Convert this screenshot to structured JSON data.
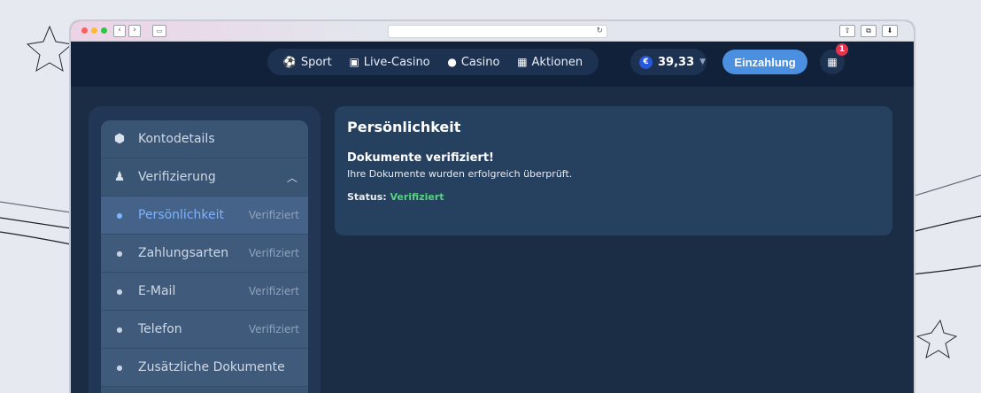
{
  "nav": {
    "items": [
      {
        "label": "Sport",
        "icon": "soccer-ball-icon"
      },
      {
        "label": "Live-Casino",
        "icon": "live-tv-icon"
      },
      {
        "label": "Casino",
        "icon": "casino-chip-icon"
      },
      {
        "label": "Aktionen",
        "icon": "gift-icon"
      }
    ],
    "currency_symbol": "€",
    "balance": "39,33",
    "deposit_label": "Einzahlung",
    "gift_badge": "1"
  },
  "sidebar": {
    "items": [
      {
        "label": "Kontodetails",
        "icon": "account-shield-icon"
      },
      {
        "label": "Verifizierung",
        "icon": "user-icon"
      }
    ],
    "sub_items": [
      {
        "label": "Persönlichkeit",
        "status": "Verifiziert"
      },
      {
        "label": "Zahlungsarten",
        "status": "Verifiziert"
      },
      {
        "label": "E-Mail",
        "status": "Verifiziert"
      },
      {
        "label": "Telefon",
        "status": "Verifiziert"
      },
      {
        "label": "Zusätzliche Dokumente",
        "status": ""
      }
    ]
  },
  "main": {
    "title": "Persönlichkeit",
    "heading": "Dokumente verifiziert!",
    "text": "Ihre Dokumente wurden erfolgreich überprüft.",
    "status_label": "Status:",
    "status_value": "Verifiziert"
  },
  "colors": {
    "accent": "#4a8fe0",
    "success": "#55d27f",
    "badge": "#e2344f"
  }
}
